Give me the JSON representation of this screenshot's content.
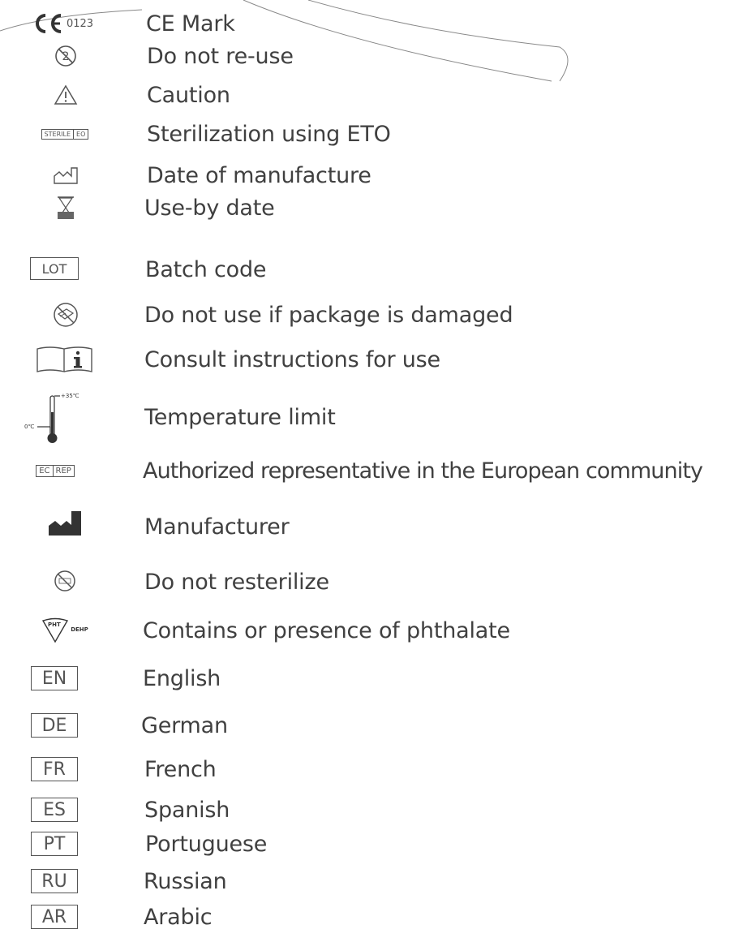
{
  "symbols": [
    {
      "icon": "ce-mark-icon",
      "code": "0123",
      "label": "CE Mark"
    },
    {
      "icon": "do-not-reuse-icon",
      "label": "Do not re-use"
    },
    {
      "icon": "caution-icon",
      "label": "Caution"
    },
    {
      "icon": "sterile-eo-icon",
      "codes": [
        "STERILE",
        "EO"
      ],
      "label": "Sterilization using ETO"
    },
    {
      "icon": "date-of-manufacture-icon",
      "label": "Date of manufacture"
    },
    {
      "icon": "use-by-date-icon",
      "label": "Use-by date"
    },
    {
      "icon": "batch-code-icon",
      "code": "LOT",
      "label": "Batch code"
    },
    {
      "icon": "do-not-use-if-damaged-icon",
      "label": "Do not use if package is damaged"
    },
    {
      "icon": "consult-instructions-icon",
      "label": "Consult instructions for use"
    },
    {
      "icon": "temperature-limit-icon",
      "low": "0℃",
      "high": "+35℃",
      "label": "Temperature limit"
    },
    {
      "icon": "ec-rep-icon",
      "codes": [
        "EC",
        "REP"
      ],
      "label": "Authorized representative in the European community"
    },
    {
      "icon": "manufacturer-icon",
      "label": "Manufacturer"
    },
    {
      "icon": "do-not-resterilize-icon",
      "label": "Do not resterilize"
    },
    {
      "icon": "phthalate-icon",
      "codes": [
        "PHT",
        "DEHP"
      ],
      "label": "Contains or presence of phthalate"
    },
    {
      "icon": "language-box-icon",
      "code": "EN",
      "label": "English"
    },
    {
      "icon": "language-box-icon",
      "code": "DE",
      "label": "German"
    },
    {
      "icon": "language-box-icon",
      "code": "FR",
      "label": "French"
    },
    {
      "icon": "language-box-icon",
      "code": "ES",
      "label": "Spanish"
    },
    {
      "icon": "language-box-icon",
      "code": "PT",
      "label": "Portuguese"
    },
    {
      "icon": "language-box-icon",
      "code": "RU",
      "label": "Russian"
    },
    {
      "icon": "language-box-icon",
      "code": "AR",
      "label": "Arabic"
    }
  ]
}
